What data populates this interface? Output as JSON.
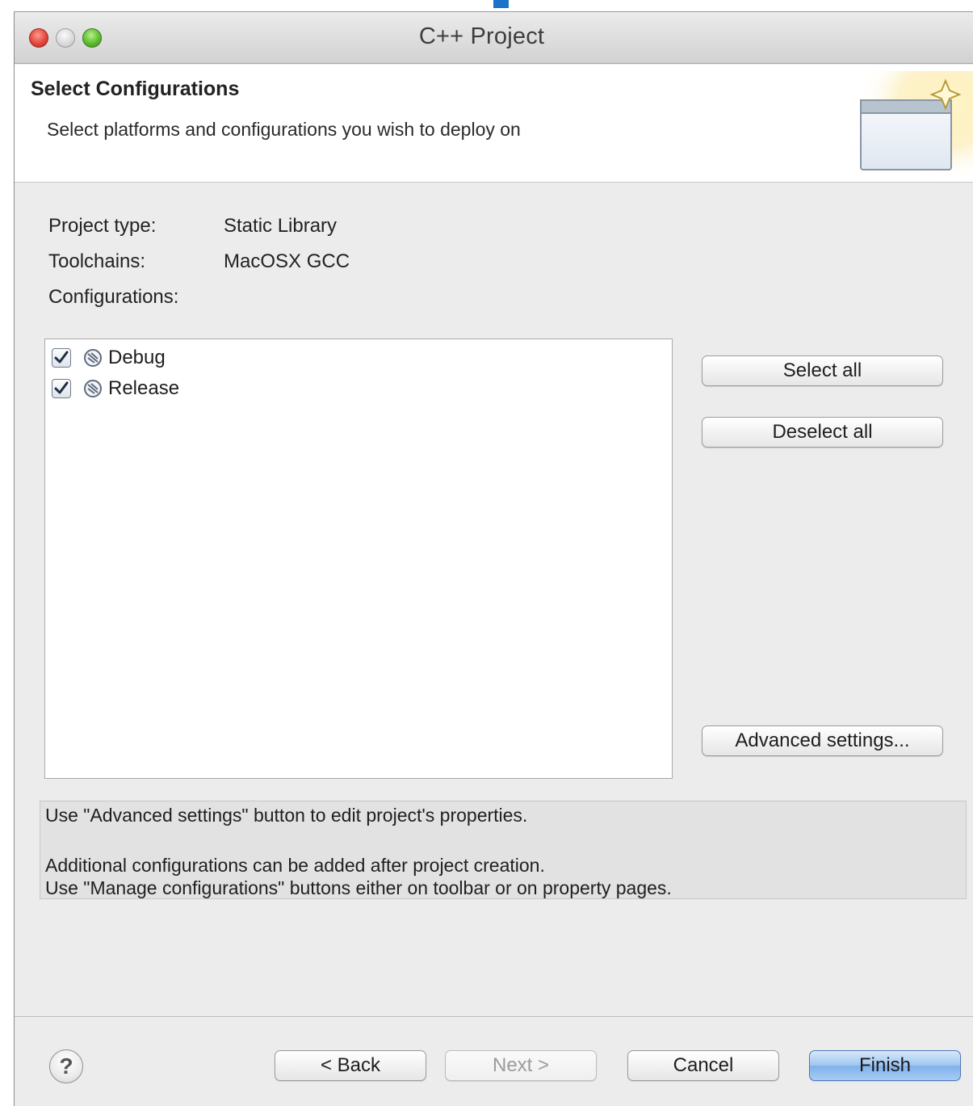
{
  "window": {
    "title": "C++ Project"
  },
  "banner": {
    "title": "Select Configurations",
    "subtitle": "Select platforms and configurations you wish to deploy on"
  },
  "info": {
    "project_type_label": "Project type:",
    "project_type_value": "Static Library",
    "toolchains_label": "Toolchains:",
    "toolchains_value": "MacOSX GCC",
    "configurations_label": "Configurations:"
  },
  "configurations": [
    {
      "label": "Debug",
      "checked": true
    },
    {
      "label": "Release",
      "checked": true
    }
  ],
  "side_buttons": {
    "select_all": "Select all",
    "deselect_all": "Deselect all",
    "advanced_settings": "Advanced settings..."
  },
  "message": {
    "line1": "Use \"Advanced settings\" button to edit project's properties.",
    "line2": "Additional configurations can be added after project creation.",
    "line3": "Use \"Manage configurations\" buttons either on toolbar or on property pages."
  },
  "footer": {
    "help": "?",
    "back": "< Back",
    "next": "Next >",
    "cancel": "Cancel",
    "finish": "Finish"
  },
  "colors": {
    "accent_blue": "#1a73c8",
    "default_button": "#7fb1ea",
    "window_bg": "#ececec"
  }
}
